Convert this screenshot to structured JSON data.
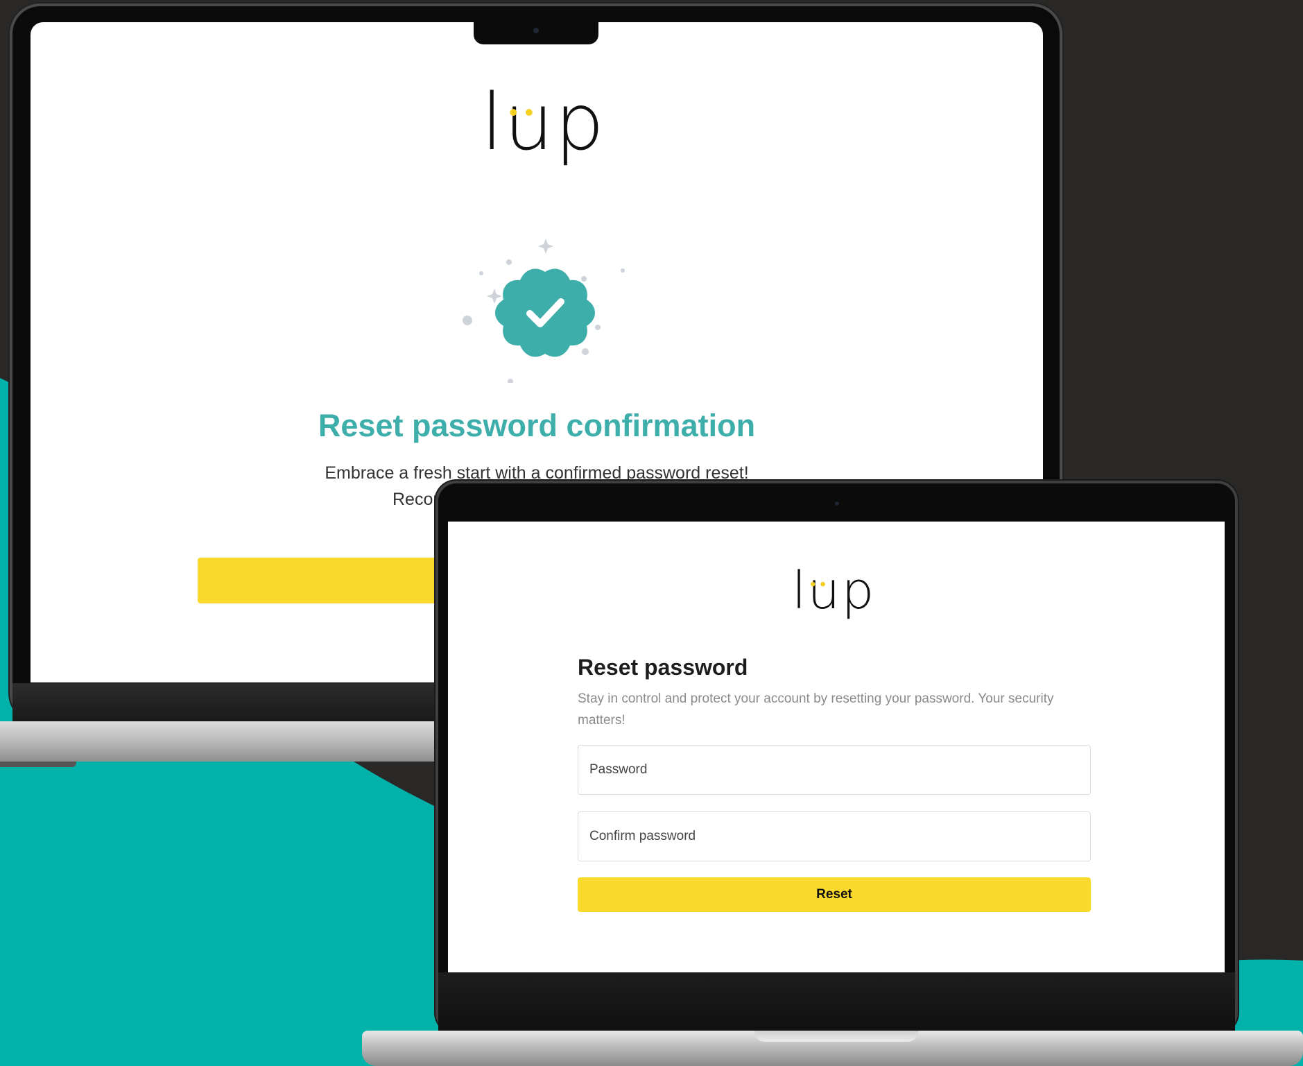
{
  "brand": {
    "logo_text": "lup",
    "logo_dots": "••",
    "accent_yellow": "#f9d92c",
    "accent_teal": "#3eaeab",
    "background_dark": "#2a2826",
    "background_teal": "#00b2aa"
  },
  "confirmation_screen": {
    "badge_icon": "check-badge-icon",
    "title": "Reset password confirmation",
    "subtitle_line1": "Embrace a fresh start with a confirmed password reset!",
    "subtitle_line2_visible": "Recor"
  },
  "reset_screen": {
    "title": "Reset password",
    "description": "Stay in control and protect your account by resetting your password. Your security matters!",
    "password_placeholder": "Password",
    "confirm_password_placeholder": "Confirm password",
    "reset_button_label": "Reset"
  }
}
